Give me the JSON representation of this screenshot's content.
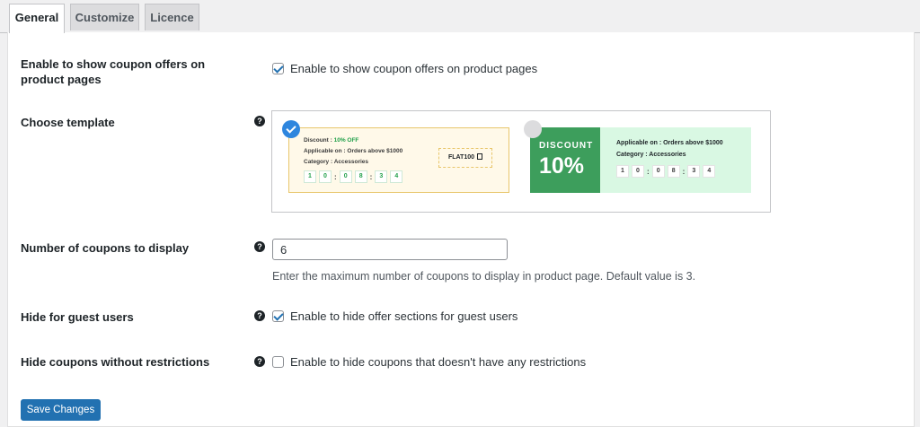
{
  "tabs": [
    {
      "label": "General",
      "active": true
    },
    {
      "label": "Customize",
      "active": false
    },
    {
      "label": "Licence",
      "active": false
    }
  ],
  "settings": {
    "show_offers": {
      "label": "Enable to show coupon offers on product pages",
      "checkbox_label": "Enable to show coupon offers on product pages",
      "checked": true
    },
    "template": {
      "label": "Choose template",
      "template1": {
        "discount_prefix": "Discount : ",
        "discount_value": "10% OFF",
        "applicable": "Applicable on : Orders above $1000",
        "category": "Category : Accessories",
        "code": "FLAT100",
        "timer": [
          "1",
          "0",
          "0",
          "8",
          "3",
          "4"
        ],
        "selected": true
      },
      "template2": {
        "discount_word": "DISCOUNT",
        "discount_value": "10%",
        "applicable": "Applicable on : Orders above $1000",
        "category": "Category : Accessories",
        "timer": [
          "1",
          "0",
          "0",
          "8",
          "3",
          "4"
        ],
        "selected": false
      }
    },
    "num_coupons": {
      "label": "Number of coupons to display",
      "value": "6",
      "description": "Enter the maximum number of coupons to display in product page. Default value is 3."
    },
    "hide_guest": {
      "label": "Hide for guest users",
      "checkbox_label": "Enable to hide offer sections for guest users",
      "checked": true
    },
    "hide_unrestricted": {
      "label": "Hide coupons without restrictions",
      "checkbox_label": "Enable to hide coupons that doesn't have any restrictions",
      "checked": false
    }
  },
  "save_button": "Save Changes",
  "colors": {
    "primary": "#2271b1",
    "template1_bg": "#fff9e9",
    "template1_accent": "#21a04a",
    "template2_dark": "#3d9e5c",
    "template2_bg": "#d9f8e3",
    "selected_badge": "#2e86de"
  }
}
